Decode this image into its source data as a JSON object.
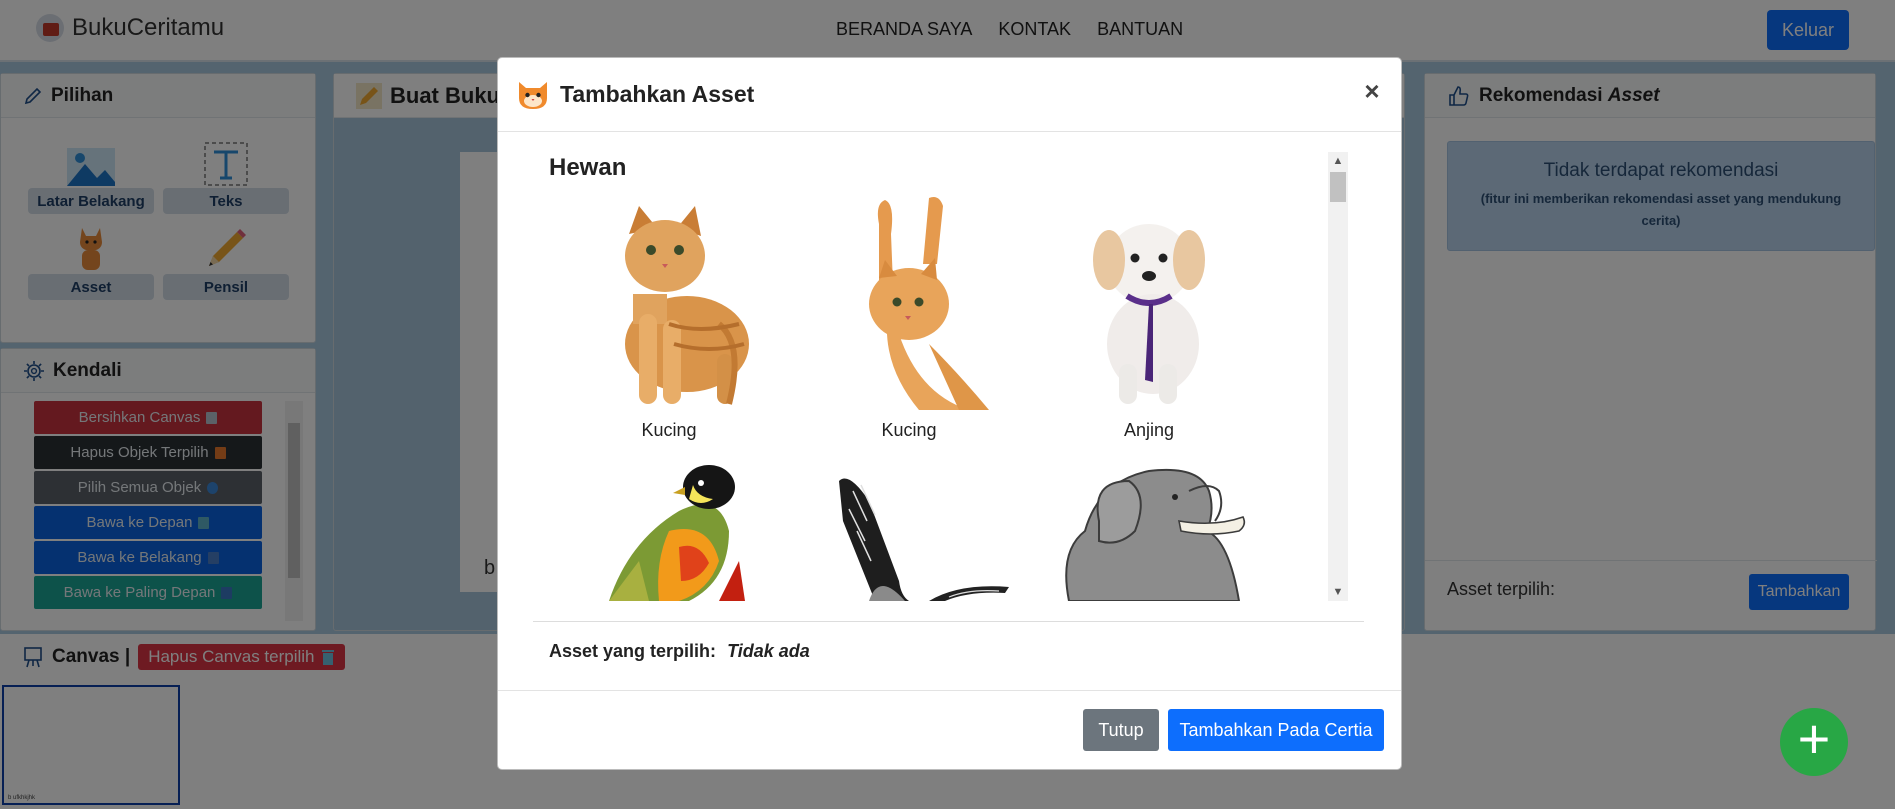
{
  "app": {
    "brand": "BukuCeritamu",
    "nav": [
      "BERANDA SAYA",
      "KONTAK",
      "BANTUAN"
    ],
    "logout_label": "Keluar"
  },
  "pilihan": {
    "title": "Pilihan",
    "tools": [
      {
        "label": "Latar Belakang",
        "icon": "landscape-icon"
      },
      {
        "label": "Teks",
        "icon": "text-icon"
      },
      {
        "label": "Asset",
        "icon": "cat-icon"
      },
      {
        "label": "Pensil",
        "icon": "pencil-icon"
      }
    ]
  },
  "kendali": {
    "title": "Kendali",
    "controls": [
      {
        "label": "Bersihkan Canvas",
        "color": "#dc3545"
      },
      {
        "label": "Hapus Objek Terpilih",
        "color": "#343a40"
      },
      {
        "label": "Pilih Semua Objek",
        "color": "#6c757d"
      },
      {
        "label": "Bawa ke Depan",
        "color": "#0d6efd"
      },
      {
        "label": "Bawa ke Belakang",
        "color": "#0d6efd"
      },
      {
        "label": "Bawa ke Paling Depan",
        "color": "#20c997"
      }
    ]
  },
  "buat": {
    "title": "Buat Buku",
    "canvas_text": "b"
  },
  "rekomendasi": {
    "title": "Rekomendasi",
    "title_em": "Asset",
    "empty_title": "Tidak terdapat rekomendasi",
    "empty_note": "(fitur ini memberikan rekomendasi asset yang mendukung cerita)",
    "selected_label": "Asset terpilih:",
    "add_label": "Tambahkan"
  },
  "canvas_bar": {
    "title": "Canvas |",
    "delete_label": "Hapus Canvas terpilih",
    "thumb_caption": "b ufkhkjhk"
  },
  "modal": {
    "title": "Tambahkan Asset",
    "category": "Hewan",
    "assets": [
      {
        "name": "Kucing"
      },
      {
        "name": "Kucing"
      },
      {
        "name": "Anjing"
      },
      {
        "name": ""
      },
      {
        "name": ""
      },
      {
        "name": ""
      }
    ],
    "selected_label": "Asset yang terpilih:",
    "selected_value": "Tidak ada",
    "close_label": "Tutup",
    "add_label": "Tambahkan Pada Certia"
  },
  "colors": {
    "primary": "#0d6efd",
    "danger": "#dc3545",
    "secondary": "#6c757d",
    "success": "#28a745"
  }
}
